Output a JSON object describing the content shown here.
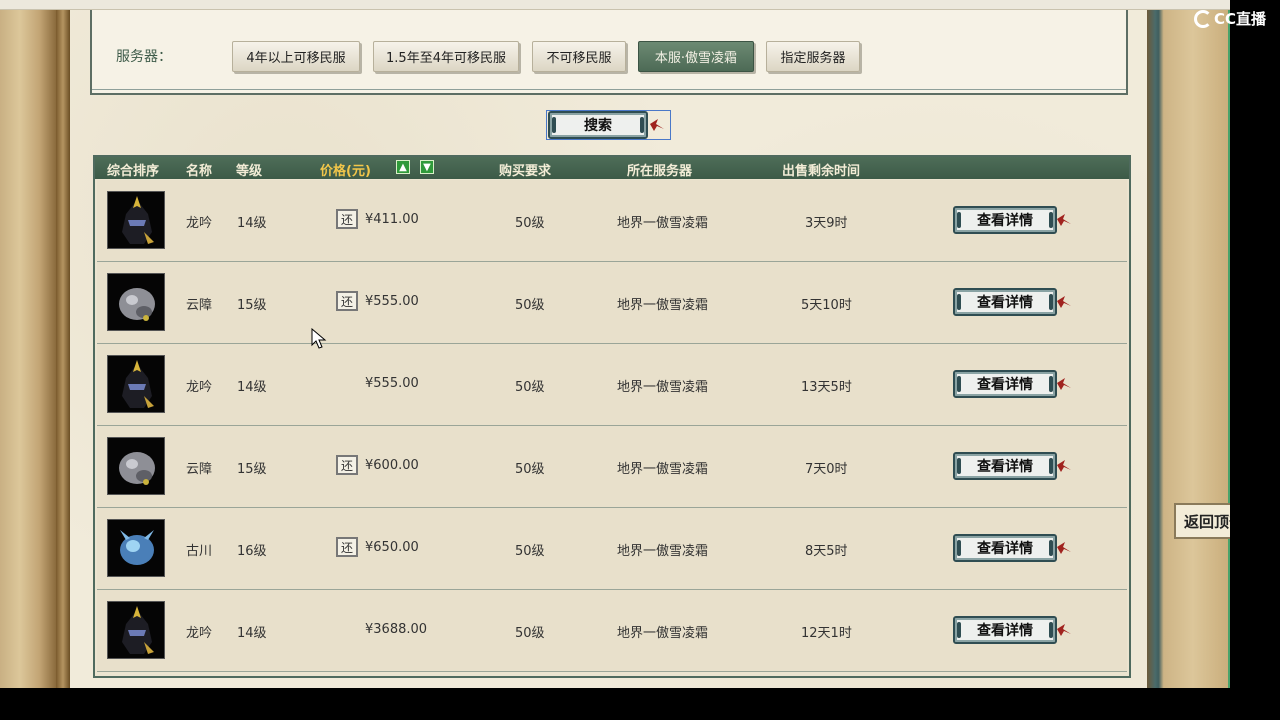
{
  "logo": {
    "text": "CC直播"
  },
  "server_filter": {
    "label": "服务器：",
    "options": [
      {
        "label": "4年以上可移民服",
        "active": false
      },
      {
        "label": "1.5年至4年可移民服",
        "active": false
      },
      {
        "label": "不可移民服",
        "active": false
      },
      {
        "label": "本服·傲雪凌霜",
        "active": true
      },
      {
        "label": "指定服务器",
        "active": false
      }
    ]
  },
  "search": {
    "label": "搜索"
  },
  "table": {
    "headers": {
      "rank": "综合排序",
      "name": "名称",
      "level": "等级",
      "price": "价格(元)",
      "requirement": "购买要求",
      "server": "所在服务器",
      "time_left": "出售剩余时间"
    },
    "rows": [
      {
        "name": "龙吟",
        "level": "14级",
        "bargain": true,
        "bargain_label": "还",
        "price": "¥411.00",
        "requirement": "50级",
        "server": "地界一傲雪凌霜",
        "time_left": "3天9时",
        "detail": "查看详情",
        "thumb": "dark-helmet"
      },
      {
        "name": "云障",
        "level": "15级",
        "bargain": true,
        "bargain_label": "还",
        "price": "¥555.00",
        "requirement": "50级",
        "server": "地界一傲雪凌霜",
        "time_left": "5天10时",
        "detail": "查看详情",
        "thumb": "grey-beast"
      },
      {
        "name": "龙吟",
        "level": "14级",
        "bargain": false,
        "bargain_label": "",
        "price": "¥555.00",
        "requirement": "50级",
        "server": "地界一傲雪凌霜",
        "time_left": "13天5时",
        "detail": "查看详情",
        "thumb": "dark-helmet"
      },
      {
        "name": "云障",
        "level": "15级",
        "bargain": true,
        "bargain_label": "还",
        "price": "¥600.00",
        "requirement": "50级",
        "server": "地界一傲雪凌霜",
        "time_left": "7天0时",
        "detail": "查看详情",
        "thumb": "grey-beast"
      },
      {
        "name": "古川",
        "level": "16级",
        "bargain": true,
        "bargain_label": "还",
        "price": "¥650.00",
        "requirement": "50级",
        "server": "地界一傲雪凌霜",
        "time_left": "8天5时",
        "detail": "查看详情",
        "thumb": "blue-beast"
      },
      {
        "name": "龙吟",
        "level": "14级",
        "bargain": false,
        "bargain_label": "",
        "price": "¥3688.00",
        "requirement": "50级",
        "server": "地界一傲雪凌霜",
        "time_left": "12天1时",
        "detail": "查看详情",
        "thumb": "dark-helmet"
      }
    ]
  },
  "back_to_top": {
    "label": "返回顶部"
  },
  "colors": {
    "header_green": "#4e6d58",
    "price_gold": "#f2c64a",
    "active_btn": "#5a7862"
  }
}
